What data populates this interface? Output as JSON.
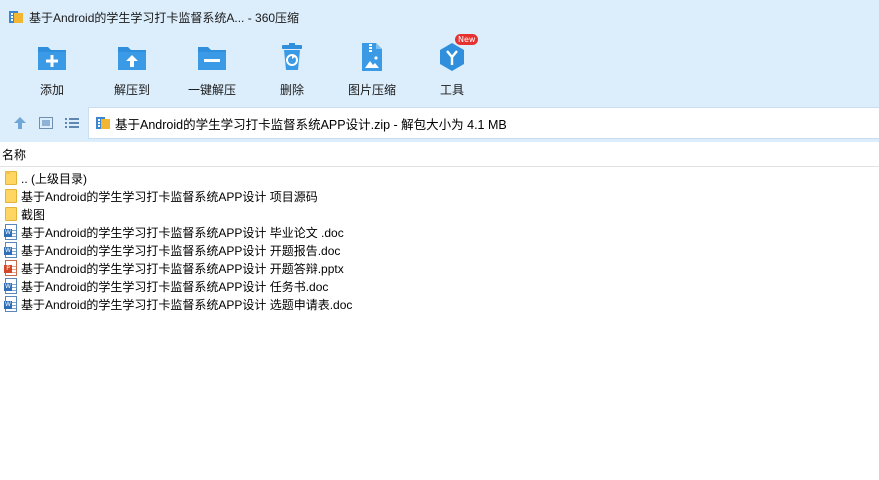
{
  "window": {
    "title": "基于Android的学生学习打卡监督系统A... - 360压缩"
  },
  "toolbar": {
    "items": [
      {
        "label": "添加",
        "icon": "add-icon",
        "color": "#2f8fdc"
      },
      {
        "label": "解压到",
        "icon": "extract-to-icon",
        "color": "#2f8fdc"
      },
      {
        "label": "一键解压",
        "icon": "one-click-extract-icon",
        "color": "#2f8fdc"
      },
      {
        "label": "删除",
        "icon": "delete-icon",
        "color": "#2f8fdc"
      },
      {
        "label": "图片压缩",
        "icon": "image-compress-icon",
        "color": "#2f8fdc"
      },
      {
        "label": "工具",
        "icon": "tools-icon",
        "color": "#2f8fdc",
        "badge": "New"
      }
    ]
  },
  "address": {
    "path": "基于Android的学生学习打卡监督系统APP设计.zip - 解包大小为 4.1 MB"
  },
  "list": {
    "header": "名称",
    "rows": [
      {
        "name": ".. (上级目录)",
        "type": "folder-up"
      },
      {
        "name": "基于Android的学生学习打卡监督系统APP设计 项目源码",
        "type": "folder"
      },
      {
        "name": "截图",
        "type": "folder"
      },
      {
        "name": "基于Android的学生学习打卡监督系统APP设计 毕业论文 .doc",
        "type": "doc"
      },
      {
        "name": "基于Android的学生学习打卡监督系统APP设计 开题报告.doc",
        "type": "doc"
      },
      {
        "name": "基于Android的学生学习打卡监督系统APP设计 开题答辩.pptx",
        "type": "ppt"
      },
      {
        "name": "基于Android的学生学习打卡监督系统APP设计 任务书.doc",
        "type": "doc"
      },
      {
        "name": "基于Android的学生学习打卡监督系统APP设计 选题申请表.doc",
        "type": "doc"
      }
    ]
  },
  "colors": {
    "chrome_bg": "#dcedfb",
    "accent": "#2f8fdc",
    "badge_red": "#e5312f"
  }
}
